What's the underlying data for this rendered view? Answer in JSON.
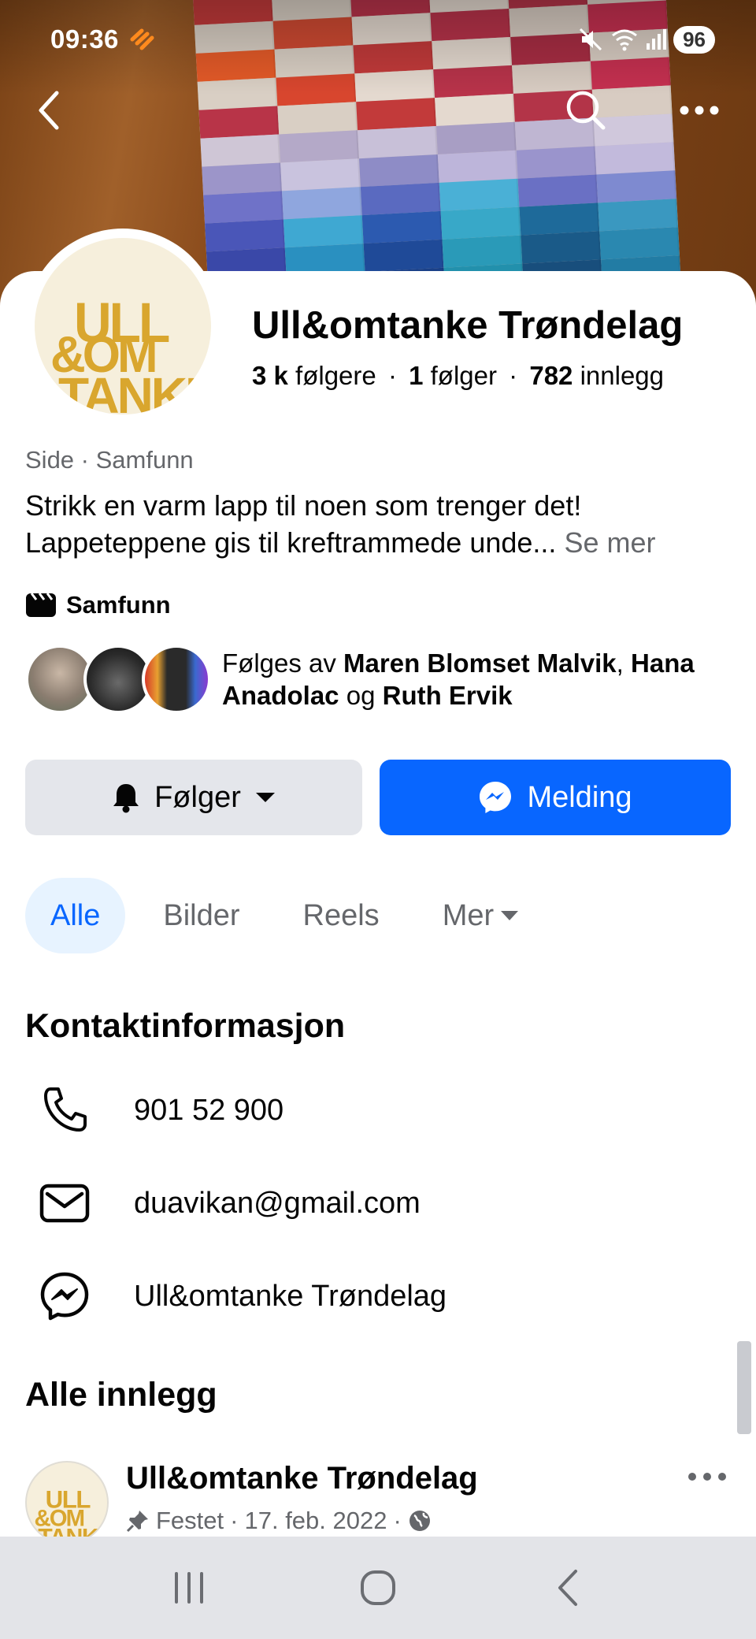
{
  "status_bar": {
    "time": "09:36",
    "battery": "96"
  },
  "profile": {
    "name": "Ull&omtanke Trøndelag",
    "stats": {
      "followers_count": "3 k",
      "followers_label": "følgere",
      "following_count": "1",
      "following_label": "følger",
      "posts_count": "782",
      "posts_label": "innlegg",
      "separator": "·"
    },
    "category_line": "Side · Samfunn",
    "bio": "Strikk en varm lapp til noen som trenger det! Lappeteppene gis til kreftrammede unde...",
    "see_more": "Se mer",
    "category": "Samfunn",
    "followed_by": {
      "prefix": "Følges av",
      "name1": "Maren Blomset Malvik",
      "comma": ",",
      "name2": "Hana Anadolac",
      "and": "og",
      "name3": "Ruth Ervik"
    }
  },
  "actions": {
    "follow_label": "Følger",
    "message_label": "Melding"
  },
  "tabs": [
    {
      "label": "Alle",
      "active": true
    },
    {
      "label": "Bilder",
      "active": false
    },
    {
      "label": "Reels",
      "active": false
    },
    {
      "label": "Mer",
      "active": false
    }
  ],
  "contact": {
    "title": "Kontaktinformasjon",
    "phone": "901 52 900",
    "email": "duavikan@gmail.com",
    "messenger": "Ull&omtanke Trøndelag"
  },
  "posts": {
    "title": "Alle innlegg",
    "first": {
      "author": "Ull&omtanke Trøndelag",
      "pinned_label": "Festet",
      "date": "17. feb. 2022"
    }
  },
  "logo_text": [
    "ULL",
    "&OM",
    "TANKE"
  ],
  "colors": {
    "accent": "#0866ff",
    "accent_light": "#e7f3ff",
    "secondary_text": "#65676b",
    "button_gray": "#e4e6eb",
    "logo_yellow": "#d9a62e"
  },
  "icons": {
    "back": "back-arrow-icon",
    "search": "search-icon",
    "more": "more-dots-icon",
    "bell": "bell-icon",
    "messenger": "messenger-icon",
    "phone": "phone-icon",
    "mail": "mail-icon",
    "category": "clapperboard-icon",
    "pin": "pin-icon",
    "globe": "globe-icon"
  }
}
